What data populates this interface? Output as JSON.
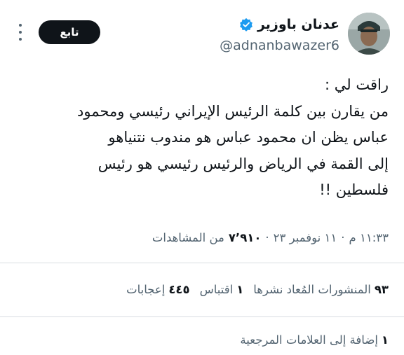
{
  "author": {
    "name": "عدنان باوزير",
    "handle": "@adnanbawazer6",
    "verified_color": "#1d9bf0"
  },
  "actions": {
    "follow_label": "تابع",
    "more_icon": "more-dots-icon"
  },
  "tweet": {
    "text": "راقت لي :\nمن يقارن بين كلمة الرئيس الإيراني رئيسي ومحمود\nعباس يظن ان محمود عباس هو مندوب نتنياهو\nإلى القمة في الرياض  والرئيس رئيسي هو رئيس\nفلسطين !!"
  },
  "meta": {
    "time": "١١:٣٣ م",
    "sep1": "·",
    "date": "١١ نوفمبر ٢٣",
    "sep2": "·",
    "views": "٧٬٩١٠",
    "views_label": "من المشاهدات"
  },
  "stats": {
    "reposts": {
      "num": "٩٣",
      "label": "المنشورات المُعاد نشرها"
    },
    "quotes": {
      "num": "١",
      "label": "اقتباس"
    },
    "likes": {
      "num": "٤٤٥",
      "label": "إعجابات"
    }
  },
  "bookmarks": {
    "num": "١",
    "label": "إضافة إلى العلامات المرجعية"
  },
  "colors": {
    "text": "#0f1419",
    "secondary": "#536471",
    "divider": "#d9dde1"
  }
}
